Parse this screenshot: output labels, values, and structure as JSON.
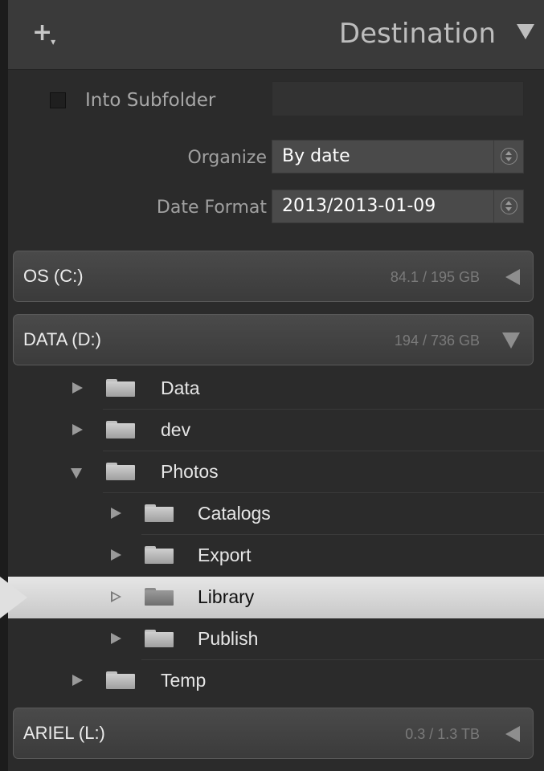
{
  "header": {
    "add_icon": "plus-dropdown-icon",
    "title": "Destination",
    "collapse_icon": "triangle-down-icon"
  },
  "subfolder": {
    "label": "Into Subfolder",
    "value": ""
  },
  "organize": {
    "label": "Organize",
    "value": "By date"
  },
  "date_format": {
    "label": "Date Format",
    "value": "2013/2013-01-09"
  },
  "volumes": [
    {
      "name": "OS (C:)",
      "size": "84.1 / 195 GB",
      "expanded": false
    },
    {
      "name": "DATA (D:)",
      "size": "194 / 736 GB",
      "expanded": true
    },
    {
      "name": "ARIEL (L:)",
      "size": "0.3 / 1.3 TB",
      "expanded": false
    }
  ],
  "folders": [
    {
      "label": "Data"
    },
    {
      "label": "dev"
    },
    {
      "label": "Photos"
    },
    {
      "label": "Catalogs"
    },
    {
      "label": "Export"
    },
    {
      "label": "Library"
    },
    {
      "label": "Publish"
    },
    {
      "label": "Temp"
    }
  ],
  "colors": {
    "panel": "#2b2b2b",
    "header": "#3a3a3a",
    "selected_row": "#dcdcdc"
  }
}
